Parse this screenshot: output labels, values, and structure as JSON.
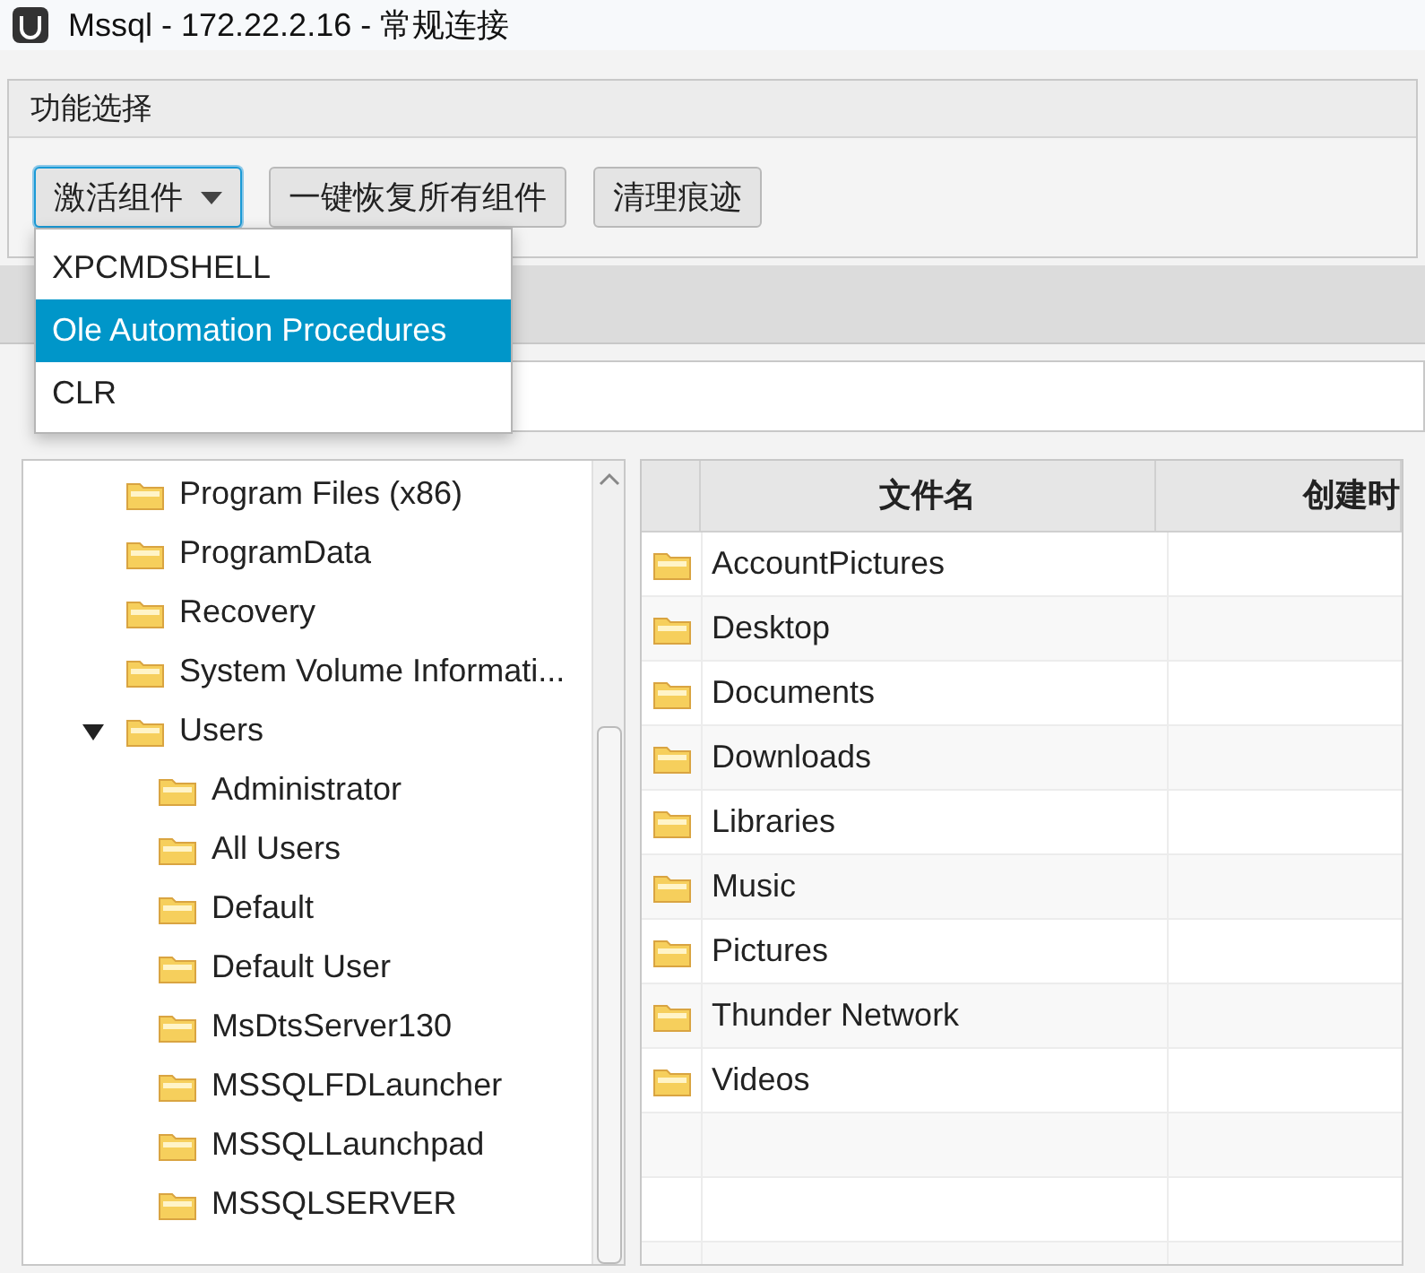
{
  "window": {
    "title": "Mssql - 172.22.2.16 - 常规连接"
  },
  "menu_bar": {
    "label": "功能选择"
  },
  "toolbar": {
    "buttons": [
      {
        "label": "激活组件",
        "kind": "dropdown",
        "focused": true
      },
      {
        "label": "一键恢复所有组件",
        "kind": "button",
        "focused": false
      },
      {
        "label": "清理痕迹",
        "kind": "button",
        "focused": false
      }
    ]
  },
  "dropdown_menu": {
    "items": [
      {
        "label": "XPCMDSHELL",
        "selected": false
      },
      {
        "label": "Ole Automation Procedures",
        "selected": true
      },
      {
        "label": "CLR",
        "selected": false
      }
    ]
  },
  "tree": {
    "items": [
      {
        "label": "Program Files (x86)"
      },
      {
        "label": "ProgramData"
      },
      {
        "label": "Recovery"
      },
      {
        "label": "System Volume Informati..."
      },
      {
        "label": "Users",
        "expanded": true,
        "children": [
          {
            "label": "Administrator"
          },
          {
            "label": "All Users"
          },
          {
            "label": "Default"
          },
          {
            "label": "Default User"
          },
          {
            "label": "MsDtsServer130"
          },
          {
            "label": "MSSQLFDLauncher"
          },
          {
            "label": "MSSQLLaunchpad"
          },
          {
            "label": "MSSQLSERVER"
          }
        ]
      }
    ]
  },
  "table": {
    "columns": [
      "文件名",
      "创建时"
    ],
    "rows": [
      {
        "name": "AccountPictures"
      },
      {
        "name": "Desktop"
      },
      {
        "name": "Documents"
      },
      {
        "name": "Downloads"
      },
      {
        "name": "Libraries"
      },
      {
        "name": "Music"
      },
      {
        "name": "Pictures"
      },
      {
        "name": "Thunder Network"
      },
      {
        "name": "Videos"
      }
    ]
  }
}
